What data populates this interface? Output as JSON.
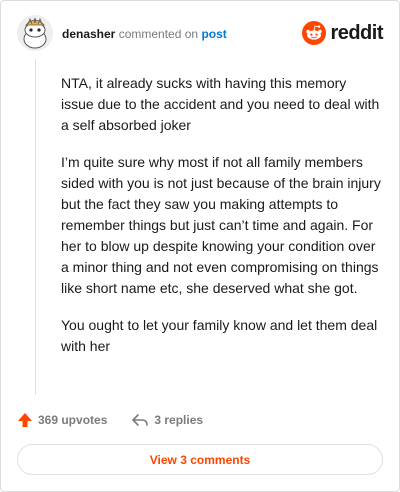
{
  "comment": {
    "username": "denasher",
    "verb": "commented on",
    "target": "post",
    "paragraphs": [
      "NTA, it already sucks with having this memory issue due to the accident and you need to deal with a self absorbed joker",
      "I’m quite sure why most if not all family members sided with you is not just because of the brain injury but the fact they saw you making attempts to remember things but just can’t time and again. For her to blow up despite knowing your condition over a minor thing and not even compromising on things like short name etc, she deserved what she got.",
      "You ought to let your family know and let them deal with her"
    ]
  },
  "brand": {
    "wordmark": "reddit",
    "icon": "reddit-logo-icon",
    "color": "#ff4500"
  },
  "actions": {
    "upvotes": "369 upvotes",
    "upvote_icon": "upvote-arrow-icon",
    "replies": "3 replies",
    "reply_icon": "reply-icon"
  },
  "view_button": {
    "label": "View 3 comments"
  },
  "colors": {
    "accent": "#ff4500",
    "link": "#0079d3",
    "muted": "#787c7e"
  }
}
